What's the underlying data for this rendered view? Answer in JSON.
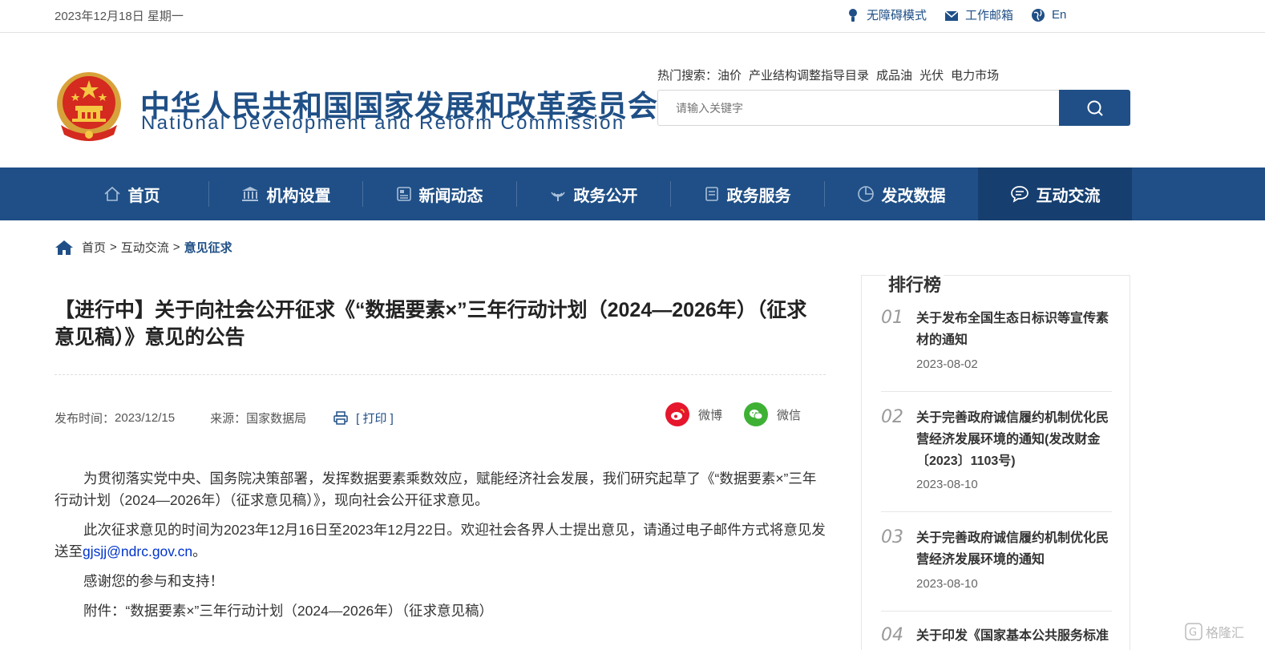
{
  "topbar": {
    "date": "2023年12月18日 星期一",
    "links": [
      {
        "label": "无障碍模式",
        "icon": "accessibility-icon"
      },
      {
        "label": "工作邮箱",
        "icon": "mail-icon"
      },
      {
        "label": "En",
        "icon": "globe-icon"
      }
    ]
  },
  "header": {
    "title_cn": "中华人民共和国国家发展和改革委员会",
    "title_en": "National Development and Reform Commission",
    "hot_label": "热门搜索：",
    "hot_terms": [
      "油价",
      "产业结构调整指导目录",
      "成品油",
      "光伏",
      "电力市场"
    ],
    "search_placeholder": "请输入关键字"
  },
  "nav": {
    "items": [
      {
        "label": "首页",
        "icon": "home-icon"
      },
      {
        "label": "机构设置",
        "icon": "building-icon"
      },
      {
        "label": "新闻动态",
        "icon": "news-icon"
      },
      {
        "label": "政务公开",
        "icon": "broadcast-icon"
      },
      {
        "label": "政务服务",
        "icon": "document-icon"
      },
      {
        "label": "发改数据",
        "icon": "pie-chart-icon"
      },
      {
        "label": "互动交流",
        "icon": "chat-icon",
        "active": true
      }
    ]
  },
  "breadcrumb": {
    "home": "首页",
    "section": "互动交流",
    "current": "意见征求",
    "sep": ">"
  },
  "article": {
    "title": "【进行中】关于向社会公开征求《“数据要素×”三年行动计划（2024—2026年）（征求意见稿）》意见的公告",
    "publish_label": "发布时间：",
    "publish_date": "2023/12/15",
    "source_label": "来源：",
    "source": "国家数据局",
    "print_label": "[ 打印 ]",
    "share": [
      {
        "label": "微博",
        "icon": "weibo-icon",
        "color": "#e6162d"
      },
      {
        "label": "微信",
        "icon": "wechat-icon",
        "color": "#3eb135"
      }
    ],
    "paragraphs": [
      "为贯彻落实党中央、国务院决策部署，发挥数据要素乘数效应，赋能经济社会发展，我们研究起草了《“数据要素×”三年行动计划（2024—2026年）（征求意见稿）》，现向社会公开征求意见。",
      "此次征求意见的时间为2023年12月16日至2023年12月22日。欢迎社会各界人士提出意见，请通过电子邮件方式将意见发送至",
      "感谢您的参与和支持！",
      "附件：“数据要素×”三年行动计划（2024—2026年）（征求意见稿）"
    ],
    "email": "gjsjj@ndrc.gov.cn",
    "email_suffix": "。"
  },
  "ranking": {
    "heading": "排行榜",
    "items": [
      {
        "num": "01",
        "title": "关于发布全国生态日标识等宣传素材的通知",
        "date": "2023-08-02"
      },
      {
        "num": "02",
        "title": "关于完善政府诚信履约机制优化民营经济发展环境的通知(发改财金〔2023〕1103号)",
        "date": "2023-08-10"
      },
      {
        "num": "03",
        "title": "关于完善政府诚信履约机制优化民营经济发展环境的通知",
        "date": "2023-08-10"
      },
      {
        "num": "04",
        "title": "关于印发《国家基本公共服务标准",
        "date": ""
      }
    ]
  },
  "watermark": "格隆汇"
}
